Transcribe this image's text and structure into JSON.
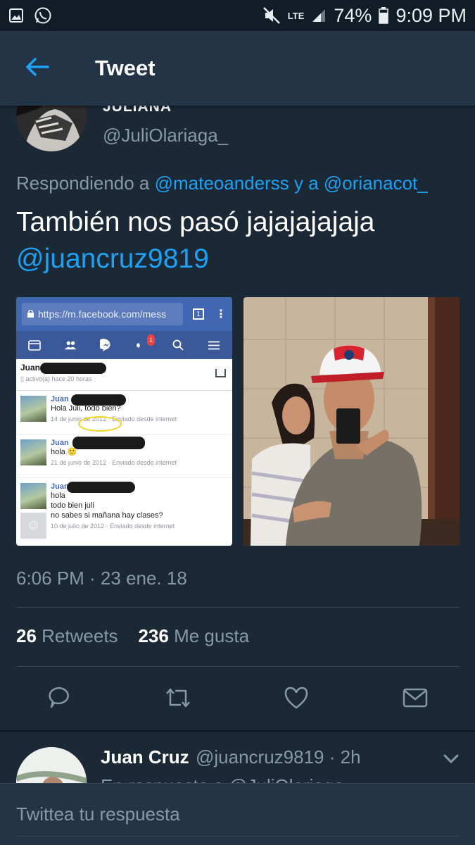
{
  "status_bar": {
    "network": "LTE",
    "battery": "74%",
    "time": "9:09 PM"
  },
  "app_bar": {
    "title": "Tweet"
  },
  "tweet": {
    "author_name": "JULIANA",
    "handle": "@JuliOlariaga_",
    "replying_prefix": "Respondiendo a ",
    "replying_to_1": "@mateoanderss",
    "replying_joiner": " y a ",
    "replying_to_2": "@orianacot_",
    "text": "También nos pasó jajajajajaja",
    "text_mention": "@juancruz9819",
    "timestamp": "6:06 PM · 23 ene. 18",
    "retweets_count": "26",
    "retweets_label": "Retweets",
    "likes_count": "236",
    "likes_label": "Me gusta"
  },
  "screenshot_media": {
    "url": "https://m.facebook.com/mess",
    "tab_count": "1",
    "notification_badge": "1",
    "contact": "Juan",
    "active_status": "activo(a) hace 20 horas",
    "messages": [
      {
        "sender": "Juan",
        "lines": [
          "Hola Juli, todo bien?"
        ],
        "date": "14 de junio de 2012 · Enviado desde internet"
      },
      {
        "sender": "Juan",
        "lines": [
          "hola 🙂"
        ],
        "date": "21 de junio de 2012 · Enviado desde internet"
      },
      {
        "sender": "Juan",
        "lines": [
          "hola",
          "todo bien juli",
          "no sabes si mañana hay clases?"
        ],
        "date": "10 de julio de 2012 · Enviado desde internet"
      }
    ]
  },
  "reply": {
    "name": "Juan Cruz",
    "handle_time": "@juancruz9819 · 2h",
    "preview": "En respuesta a @JuliOlariaga_"
  },
  "compose": {
    "placeholder": "Twittea tu respuesta"
  },
  "icons": [
    "gallery-icon",
    "whatsapp-icon",
    "mute-icon",
    "signal-icon",
    "battery-icon",
    "back-arrow-icon",
    "reply-icon",
    "retweet-icon",
    "like-icon",
    "message-icon",
    "chevron-down-icon"
  ],
  "colors": {
    "background": "#1b2836",
    "app_bar": "#243447",
    "accent": "#1da1f2",
    "secondary_text": "#8899a6"
  }
}
